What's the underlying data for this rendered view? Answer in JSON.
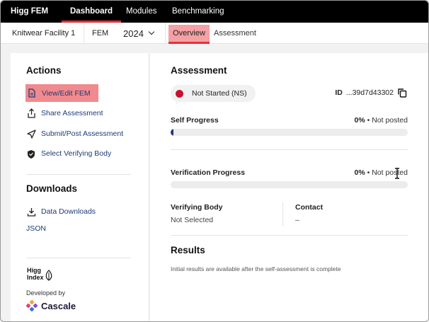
{
  "topnav": {
    "brand": "Higg FEM",
    "tabs": [
      {
        "label": "Dashboard",
        "active": true
      },
      {
        "label": "Modules",
        "active": false
      },
      {
        "label": "Benchmarking",
        "active": false
      }
    ]
  },
  "subnav": {
    "facility": "Knitwear Facility 1",
    "module": "FEM",
    "year": "2024",
    "tabs": [
      {
        "label": "Overview",
        "active": true
      },
      {
        "label": "Assessment",
        "active": false
      }
    ]
  },
  "sidebar": {
    "actions_heading": "Actions",
    "actions": [
      {
        "label": "View/Edit FEM",
        "icon": "document-icon",
        "highlighted": true
      },
      {
        "label": "Share Assessment",
        "icon": "share-icon"
      },
      {
        "label": "Submit/Post Assessment",
        "icon": "send-icon"
      },
      {
        "label": "Select Verifying Body",
        "icon": "shield-check-icon"
      }
    ],
    "downloads_heading": "Downloads",
    "downloads": [
      {
        "label": "Data Downloads",
        "icon": "download-icon"
      },
      {
        "label": "JSON"
      }
    ],
    "logo_text": "Higg Index",
    "developed_by": "Developed by",
    "developer": "Cascale"
  },
  "main": {
    "assessment_heading": "Assessment",
    "status": "Not Started (NS)",
    "status_color": "#c8102e",
    "id_label": "ID",
    "id_value": "...39d7d43302",
    "self_progress": {
      "label": "Self Progress",
      "percent": "0%",
      "status": "Not posted",
      "fill_fraction": 0.01
    },
    "verification_progress": {
      "label": "Verification Progress",
      "percent": "0%",
      "status": "Not posted",
      "fill_fraction": 0
    },
    "verifying_body": {
      "label": "Verifying Body",
      "value": "Not Selected"
    },
    "contact": {
      "label": "Contact",
      "value": "–"
    },
    "results_heading": "Results",
    "results_note": "Initial results are available after the self-assessment is complete"
  },
  "colors": {
    "accent_red": "#e4303a",
    "highlight_pink": "#f08a8e",
    "link_blue": "#1d3a78",
    "topnav_bg": "#000000"
  }
}
